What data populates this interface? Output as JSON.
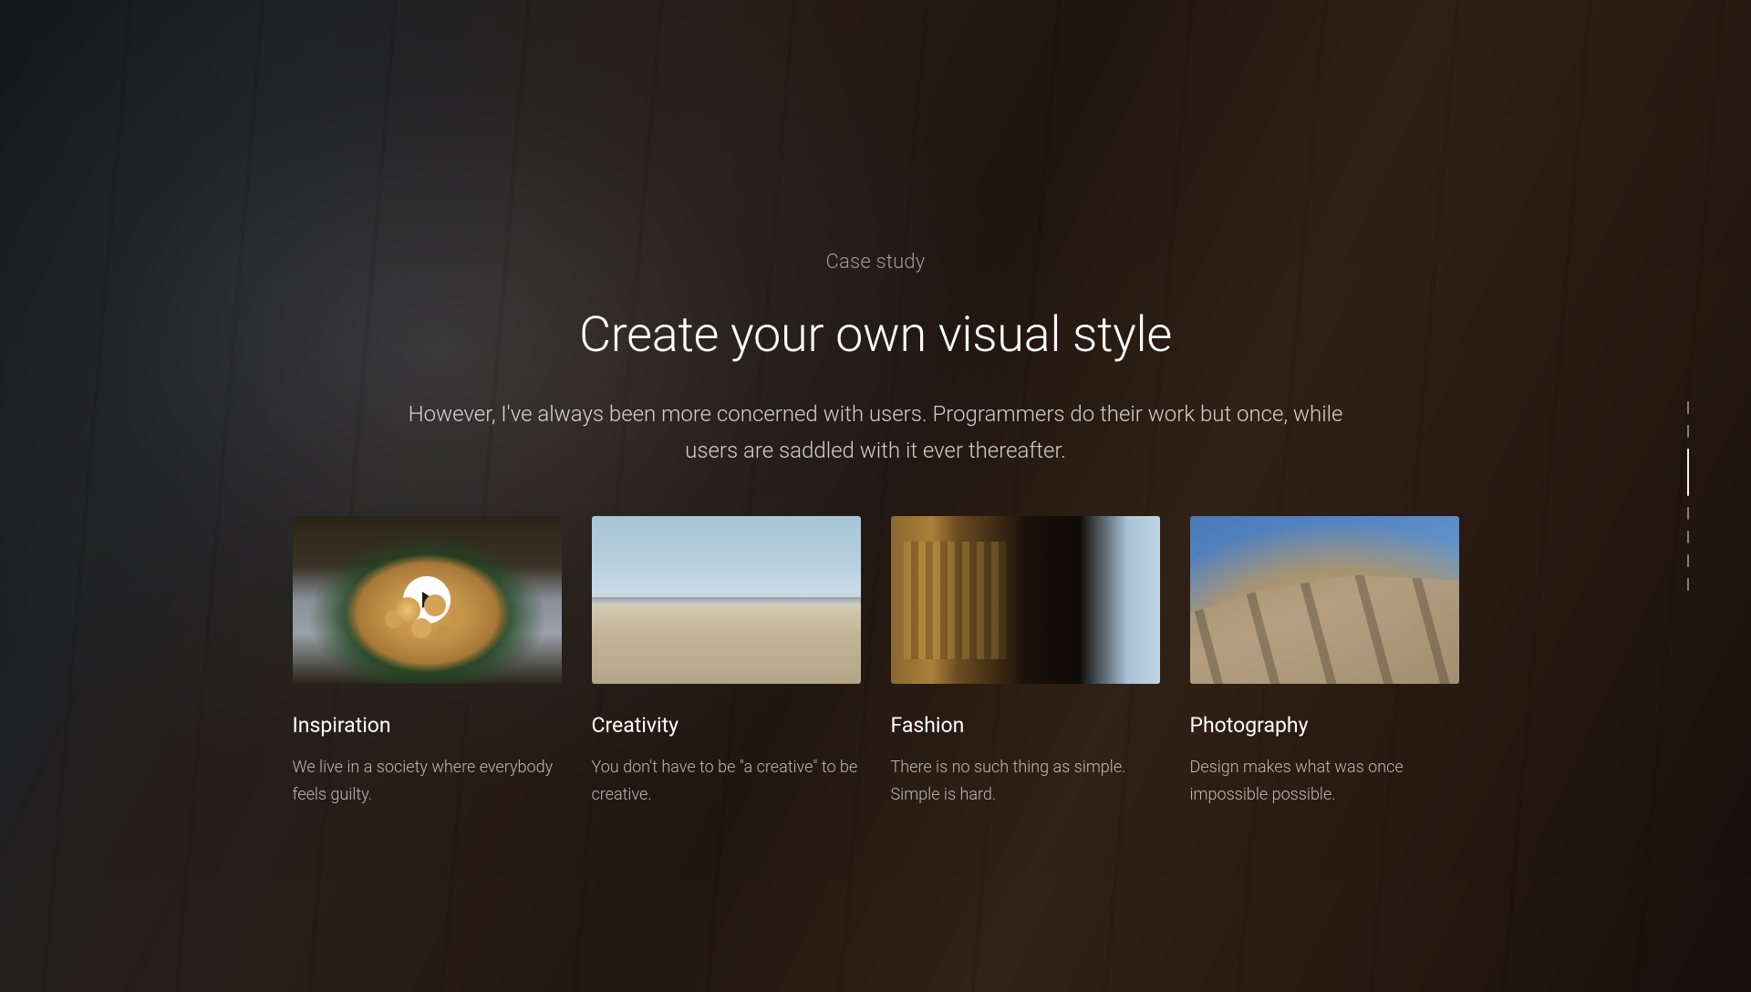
{
  "eyebrow": "Case study",
  "headline": "Create your own visual style",
  "subtext": "However, I've always been more concerned with users. Programmers do their work but once, while users are saddled with it ever thereafter.",
  "cards": [
    {
      "title": "Inspiration",
      "description": "We live in a society where everybody feels guilty.",
      "has_play": true
    },
    {
      "title": "Creativity",
      "description": "You don't have to be \"a creative\" to be creative.",
      "has_play": false
    },
    {
      "title": "Fashion",
      "description": "There is no such thing as simple. Simple is hard.",
      "has_play": false
    },
    {
      "title": "Photography",
      "description": "Design makes what was once impossible possible.",
      "has_play": false
    }
  ],
  "page_nav": {
    "total": 7,
    "active_index": 2
  }
}
